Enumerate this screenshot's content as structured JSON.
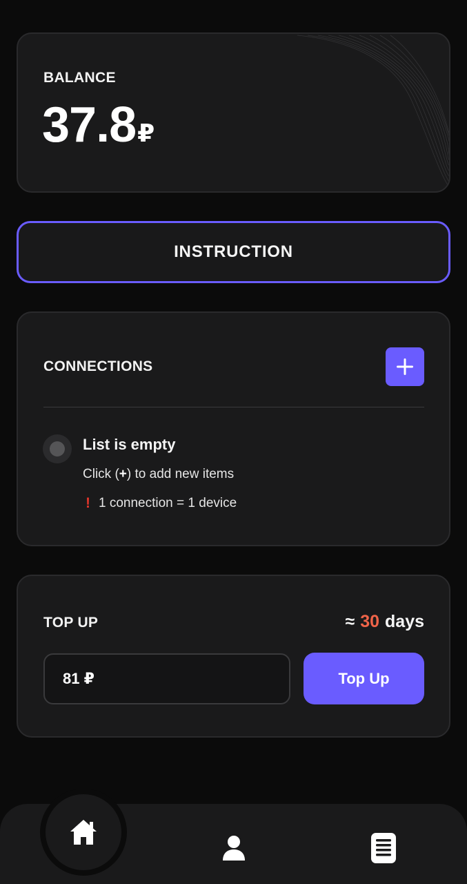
{
  "balance": {
    "label": "BALANCE",
    "amount": "37.8",
    "currency": "₽"
  },
  "instruction": {
    "label": "INSTRUCTION"
  },
  "connections": {
    "title": "CONNECTIONS",
    "add_icon": "plus-icon",
    "empty_title": "List is empty",
    "hint_before": "Click (",
    "hint_symbol": "+",
    "hint_after": ") to add new items",
    "note_icon": "exclamation-icon",
    "note": "1 connection = 1 device"
  },
  "topup": {
    "title": "TOP UP",
    "days_prefix": "≈",
    "days_value": "30",
    "days_suffix": "days",
    "amount_value": "81 ₽",
    "button_label": "Top Up"
  },
  "nav": {
    "items": [
      {
        "icon": "home-icon"
      },
      {
        "icon": "user-icon"
      },
      {
        "icon": "document-icon"
      }
    ]
  },
  "colors": {
    "accent": "#6a5cff",
    "days_highlight": "#f06449",
    "warning": "#e0352b",
    "card_bg": "#1a1a1b",
    "page_bg": "#0b0b0b"
  }
}
